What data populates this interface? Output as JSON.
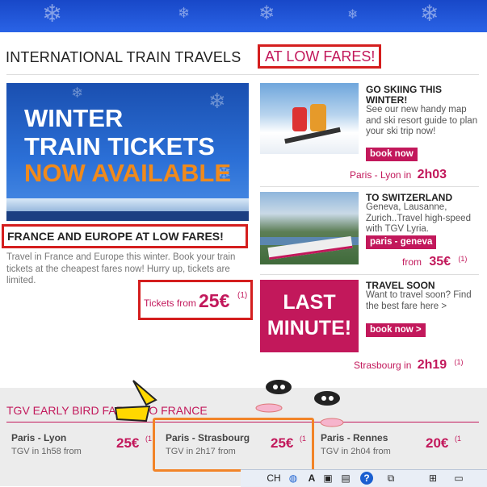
{
  "page_title": "INTERNATIONAL TRAIN TRAVELS",
  "title_accent": "AT LOW FARES!",
  "banner": {
    "line1": "WINTER",
    "line2": "TRAIN TICKETS",
    "line3": "NOW AVAILABLE"
  },
  "headline": "FRANCE AND EUROPE AT LOW FARES!",
  "description": "Travel in France and Europe this winter. Book your train tickets at the cheapest fares now! Hurry up, tickets are limited.",
  "tickets": {
    "label": "Tickets from",
    "price": "25€",
    "note": "(1)"
  },
  "promos": [
    {
      "title": "GO SKIING THIS",
      "title2": "WINTER!",
      "text": "See our new handy map and ski resort guide to plan your ski trip now!",
      "button": "book now",
      "route": "Paris - Lyon in",
      "time": "2h03",
      "note": ""
    },
    {
      "title": "TO SWITZERLAND",
      "title2": "",
      "text": "Geneva, Lausanne, Zurich..Travel high-speed with TGV Lyria.",
      "button": "paris - geneva",
      "route": "from",
      "time": "35€",
      "note": "(1)"
    },
    {
      "title": "TRAVEL SOON",
      "title2": "",
      "text": "Want to travel soon? Find the best fare here >",
      "button": "book now >",
      "route": "Strasbourg in",
      "time": "2h19",
      "note": "(1)"
    }
  ],
  "last_minute": {
    "line1": "LAST",
    "line2": "MINUTE!"
  },
  "early_bird": {
    "title": "TGV EARLY BIRD FARES TO FRANCE",
    "fares": [
      {
        "route": "Paris - Lyon",
        "duration": "TGV in 1h58 from",
        "price": "25€",
        "note": "(1"
      },
      {
        "route": "Paris - Strasbourg",
        "duration": "TGV in 2h17 from",
        "price": "25€",
        "note": "(1"
      },
      {
        "route": "Paris - Rennes",
        "duration": "TGV in 2h04 from",
        "price": "20€",
        "note": "(1"
      }
    ]
  },
  "taskbar": {
    "lang": "CH"
  },
  "colors": {
    "accent": "#c2185b",
    "highlight_red": "#d41e1e",
    "highlight_orange": "#f28428",
    "sky_blue": "#2a63e6"
  }
}
